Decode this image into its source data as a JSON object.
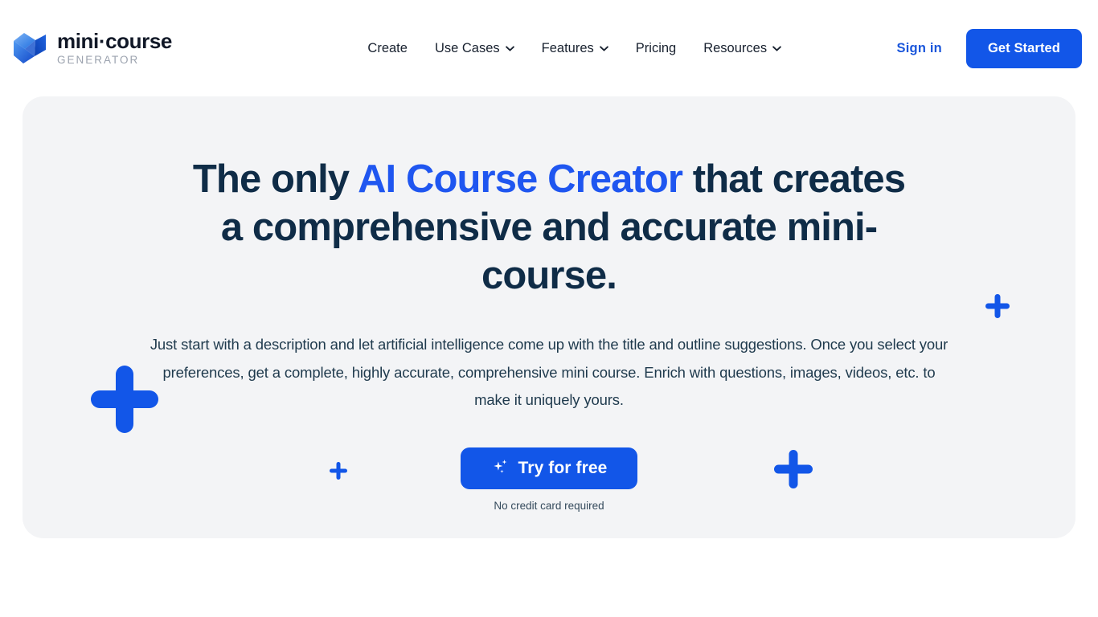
{
  "brand": {
    "name": "mini·course",
    "tagline": "GENERATOR",
    "logo_icon": "minicourse-logo-icon"
  },
  "nav": {
    "items": [
      {
        "label": "Create",
        "has_dropdown": false
      },
      {
        "label": "Use Cases",
        "has_dropdown": true
      },
      {
        "label": "Features",
        "has_dropdown": true
      },
      {
        "label": "Pricing",
        "has_dropdown": false
      },
      {
        "label": "Resources",
        "has_dropdown": true
      }
    ]
  },
  "header_actions": {
    "signin_label": "Sign in",
    "get_started_label": "Get Started"
  },
  "hero": {
    "title_part1": "The only ",
    "title_accent": "AI Course Creator",
    "title_part2": " that creates a comprehensive and accurate mini-course.",
    "subtitle": "Just start with a description and let artificial intelligence come up with the title and outline suggestions. Once you select your preferences, get a complete, highly accurate, comprehensive mini course. Enrich with questions, images, videos, etc. to make it uniquely yours.",
    "cta_label": "Try for free",
    "cta_icon": "sparkle-icon",
    "cta_note": "No credit card required"
  },
  "colors": {
    "accent_blue": "#1256e8",
    "title_accent_blue": "#1f56f0",
    "heading_navy": "#0f2c47",
    "hero_card_bg": "#f3f4f6",
    "page_bg": "#ffffff",
    "tagline_gray": "#9ca3af"
  },
  "decor": {
    "plus_marks": [
      {
        "name": "plus-decoration-large-left",
        "size": 84
      },
      {
        "name": "plus-decoration-medium-right",
        "size": 48
      },
      {
        "name": "plus-decoration-small-far-right",
        "size": 30
      },
      {
        "name": "plus-decoration-tiny-bottom-left",
        "size": 22
      }
    ]
  }
}
